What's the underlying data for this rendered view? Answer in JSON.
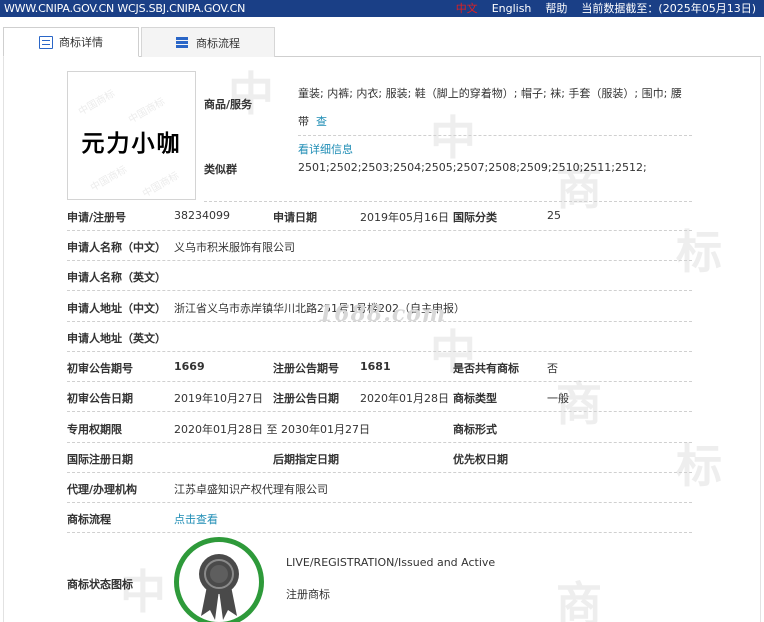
{
  "topbar": {
    "site": "WWW.CNIPA.GOV.CN WCJS.SBJ.CNIPA.GOV.CN",
    "lang_cn": "中文",
    "lang_en": "English",
    "help": "帮助",
    "data_deadline": "当前数据截至：(2025年05月13日)"
  },
  "tabs": [
    {
      "label": "商标详情",
      "icon": "document-icon",
      "active": true
    },
    {
      "label": "商标流程",
      "icon": "list-icon",
      "active": false
    }
  ],
  "logo": {
    "text": "元力小咖",
    "stamp": "中国商标"
  },
  "goods": {
    "label": "商品/服务",
    "value": "童装; 内裤; 内衣; 服装; 鞋（脚上的穿着物）; 帽子; 袜; 手套（服装）; 围巾; 腰带",
    "more_link": "查看详细信息",
    "more_link_a": "查",
    "more_link_b": "看详细信息"
  },
  "similar_group": {
    "label": "类似群",
    "value": "2501;2502;2503;2504;2505;2507;2508;2509;2510;2511;2512;"
  },
  "fields": {
    "app_no_label": "申请/注册号",
    "app_no": "38234099",
    "app_date_label": "申请日期",
    "app_date": "2019年05月16日",
    "intl_class_label": "国际分类",
    "intl_class": "25",
    "applicant_cn_label": "申请人名称（中文）",
    "applicant_cn": "义乌市积米服饰有限公司",
    "applicant_en_label": "申请人名称（英文）",
    "applicant_en": "",
    "address_cn_label": "申请人地址（中文）",
    "address_cn": "浙江省义乌市赤岸镇华川北路251号1号楼202（自主申报）",
    "address_en_label": "申请人地址（英文）",
    "address_en": "",
    "prelim_no_label": "初审公告期号",
    "prelim_no": "1669",
    "reg_no_label": "注册公告期号",
    "reg_no": "1681",
    "shared_label": "是否共有商标",
    "shared": "否",
    "prelim_date_label": "初审公告日期",
    "prelim_date": "2019年10月27日",
    "reg_date_label": "注册公告日期",
    "reg_date": "2020年01月28日",
    "mark_type_label": "商标类型",
    "mark_type": "一般",
    "exclusive_label": "专用权期限",
    "exclusive": "2020年01月28日 至 2030年01月27日",
    "mark_form_label": "商标形式",
    "mark_form": "",
    "intl_reg_date_label": "国际注册日期",
    "intl_reg_date": "",
    "later_date_label": "后期指定日期",
    "later_date": "",
    "priority_label": "优先权日期",
    "priority": "",
    "agent_label": "代理/办理机构",
    "agent": "江苏卓盛知识产权代理有限公司",
    "flow_label": "商标流程",
    "flow_link": "点击查看",
    "status_icon_label": "商标状态图标",
    "status_en": "LIVE/REGISTRATION/Issued and Active",
    "status_cn": "注册商标"
  },
  "watermark_1688": "1688.com",
  "colors": {
    "topbar": "#1a3f86",
    "link": "#1f8db5",
    "status_ring": "#2e9a3a",
    "lang_active": "#e02020"
  }
}
